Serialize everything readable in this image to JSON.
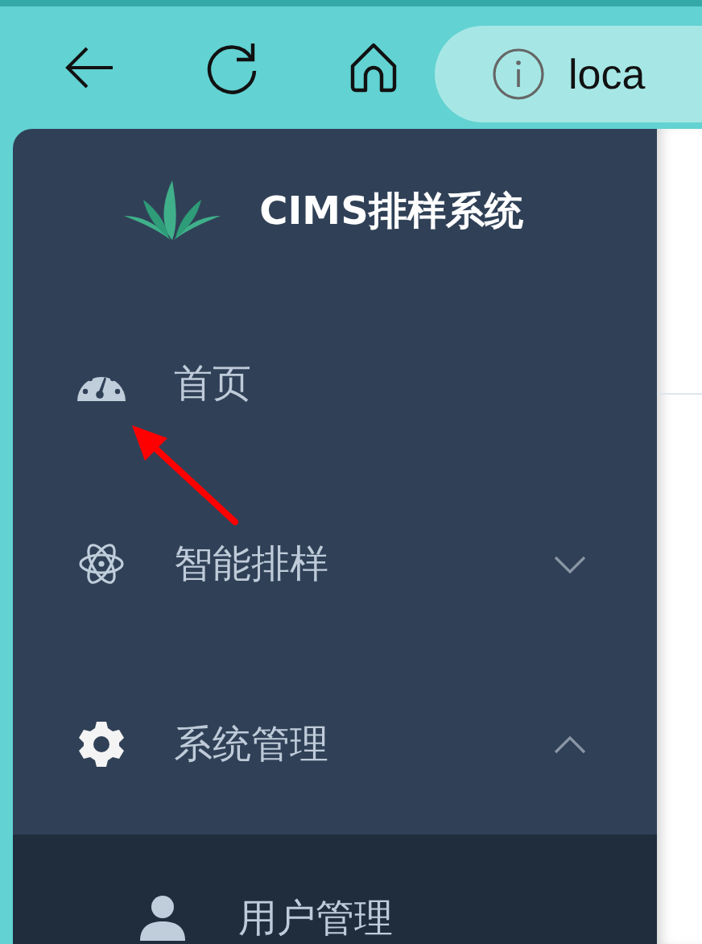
{
  "browser": {
    "address": "loca"
  },
  "sidebar": {
    "title": "CIMS排样系统",
    "menu": [
      {
        "label": "首页"
      },
      {
        "label": "智能排样",
        "expanded": false
      },
      {
        "label": "系统管理",
        "expanded": true,
        "children": [
          {
            "label": "用户管理"
          }
        ]
      }
    ]
  }
}
